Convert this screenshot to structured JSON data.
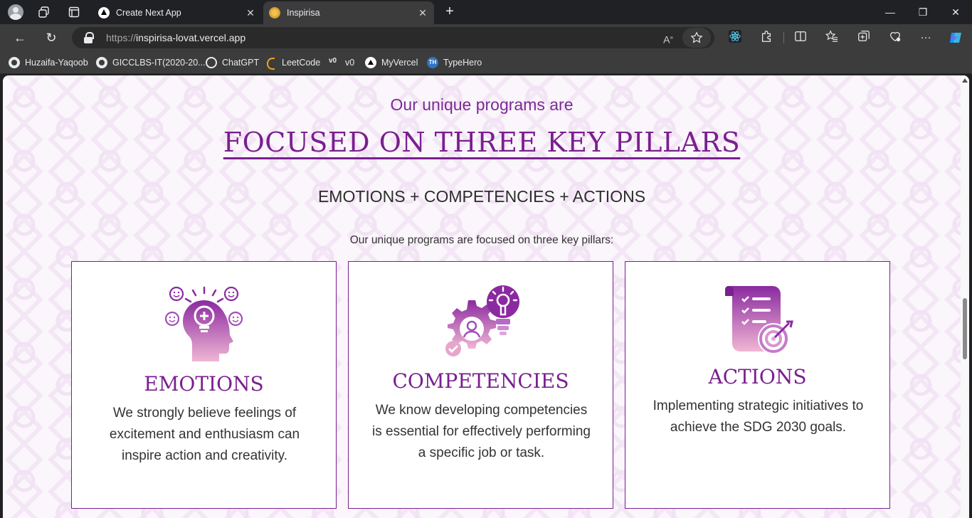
{
  "browser": {
    "tabs": [
      {
        "title": "Create Next App",
        "active": false
      },
      {
        "title": "Inspirisa",
        "active": true
      }
    ],
    "url_scheme": "https://",
    "url_host": "inspirisa-lovat.vercel.app",
    "bookmarks": [
      {
        "label": "Huzaifa-Yaqoob",
        "icon": "github-icon"
      },
      {
        "label": "GICCLBS-IT(2020-20...",
        "icon": "github-icon"
      },
      {
        "label": "ChatGPT",
        "icon": "chatgpt-icon"
      },
      {
        "label": "LeetCode",
        "icon": "leetcode-icon"
      },
      {
        "label": "v0",
        "icon": "v0-icon"
      },
      {
        "label": "MyVercel",
        "icon": "vercel-icon"
      },
      {
        "label": "TypeHero",
        "icon": "typehero-icon"
      }
    ]
  },
  "page": {
    "intro": "Our unique programs are",
    "headline": "FOCUSED ON THREE KEY PILLARS",
    "formula": "EMOTIONS + COMPETENCIES + ACTIONS",
    "subtitle": "Our unique programs are focused on three key pillars:",
    "accent_color": "#7a1f8f",
    "pillars": [
      {
        "title": "EMOTIONS",
        "icon": "head-lightbulb-emotions-icon",
        "body": "We strongly believe feelings of excitement and enthusiasm can inspire action and creativity."
      },
      {
        "title": "COMPETENCIES",
        "icon": "gear-person-lightbulb-icon",
        "body": "We know developing competencies is essential for effectively performing a specific job or task."
      },
      {
        "title": "ACTIONS",
        "icon": "checklist-target-icon",
        "body": "Implementing strategic initiatives to achieve the SDG 2030 goals."
      }
    ]
  }
}
